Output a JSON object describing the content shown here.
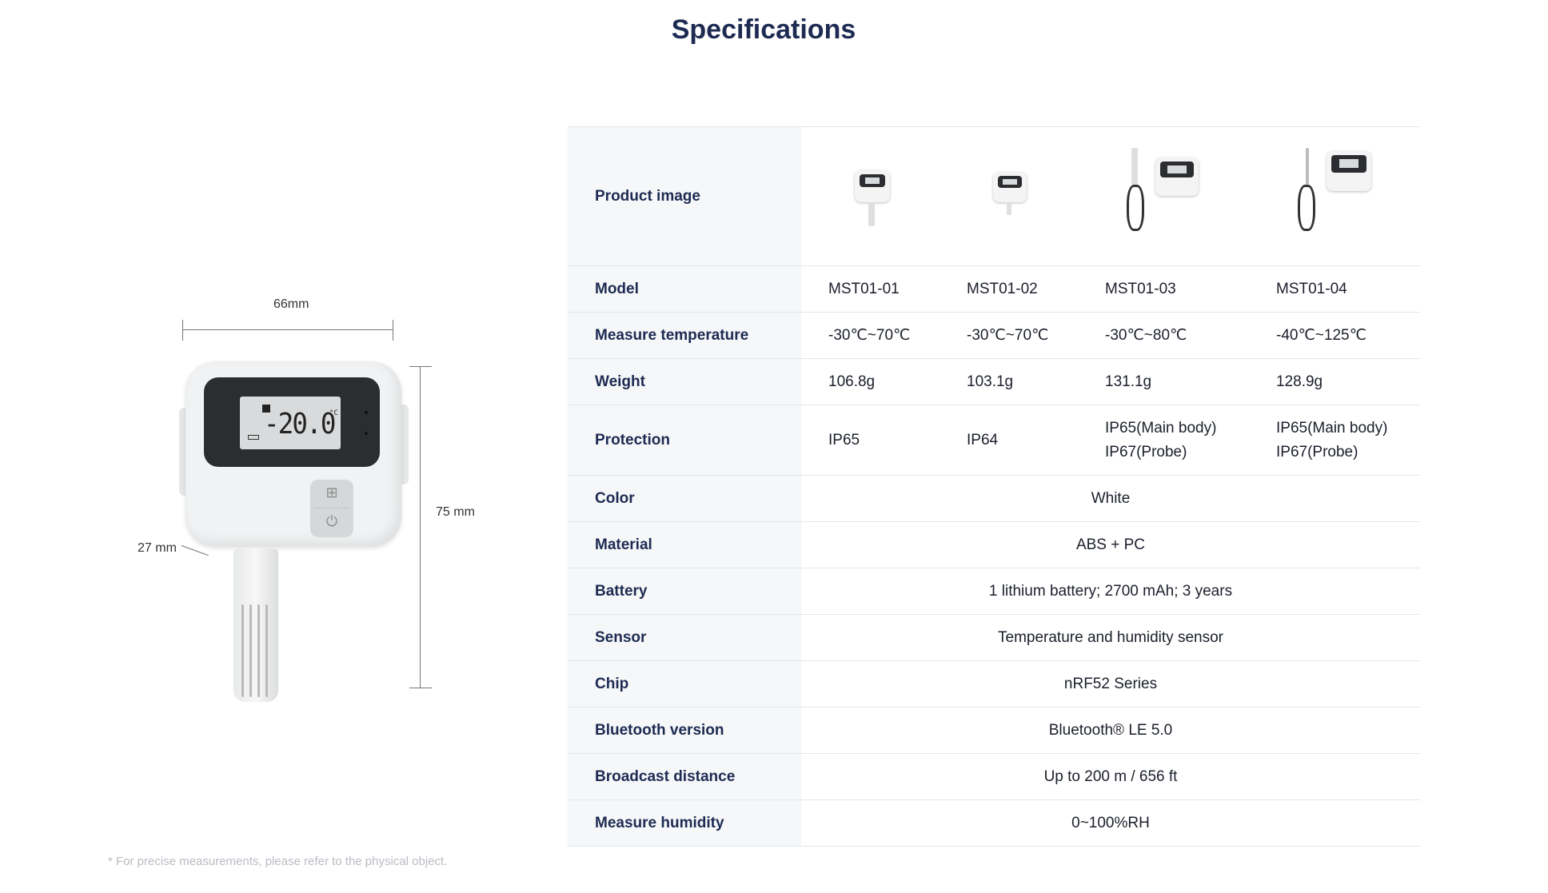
{
  "page": {
    "title": "Specifications",
    "footnote": "* For precise measurements, please refer to the physical object."
  },
  "diagram": {
    "width_label": "66mm",
    "height_label": "75 mm",
    "depth_label": "27 mm",
    "lcd_reading": "-20.0",
    "lcd_unit": "°C"
  },
  "table": {
    "rows": {
      "product_image": {
        "label": "Product image"
      },
      "model": {
        "label": "Model",
        "values": [
          "MST01-01",
          "MST01-02",
          "MST01-03",
          "MST01-04"
        ]
      },
      "measure_temperature": {
        "label": "Measure temperature",
        "values": [
          "-30℃~70℃",
          "-30℃~70℃",
          "-30℃~80℃",
          "-40℃~125℃"
        ]
      },
      "weight": {
        "label": "Weight",
        "values": [
          "106.8g",
          "103.1g",
          "131.1g",
          "128.9g"
        ]
      },
      "protection": {
        "label": "Protection",
        "values": [
          [
            "IP65"
          ],
          [
            "IP64"
          ],
          [
            "IP65(Main body)",
            "IP67(Probe)"
          ],
          [
            "IP65(Main body)",
            "IP67(Probe)"
          ]
        ]
      },
      "color": {
        "label": "Color",
        "value": "White"
      },
      "material": {
        "label": "Material",
        "value": "ABS + PC"
      },
      "battery": {
        "label": "Battery",
        "value": "1 lithium battery; 2700 mAh; 3 years"
      },
      "sensor": {
        "label": "Sensor",
        "value": "Temperature and humidity sensor"
      },
      "chip": {
        "label": "Chip",
        "value": "nRF52 Series"
      },
      "bluetooth_version": {
        "label": "Bluetooth version",
        "value": "Bluetooth® LE 5.0"
      },
      "broadcast_distance": {
        "label": "Broadcast distance",
        "value": "Up to 200 m / 656 ft"
      },
      "measure_humidity": {
        "label": "Measure humidity",
        "value": "0~100%RH"
      }
    }
  },
  "colors": {
    "title": "#1d2b52",
    "label_column_bg": "#f6f7f9",
    "row_border": "#e4e6ea",
    "footnote": "#b9bcc2"
  }
}
